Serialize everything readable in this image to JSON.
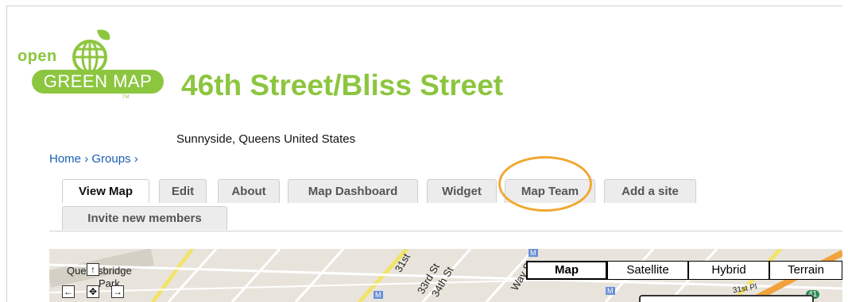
{
  "logo": {
    "open": "open",
    "name": "GREEN MAP",
    "tm": "TM"
  },
  "page": {
    "title": "46th Street/Bliss Street",
    "location": "Sunnyside, Queens United States"
  },
  "breadcrumb": {
    "items": [
      "Home",
      "Groups"
    ],
    "separator": "›"
  },
  "tabs": [
    {
      "label": "View Map",
      "active": true
    },
    {
      "label": "Edit"
    },
    {
      "label": "About"
    },
    {
      "label": "Map Dashboard"
    },
    {
      "label": "Widget"
    },
    {
      "label": "Map Team"
    },
    {
      "label": "Add a site"
    },
    {
      "label": "Invite new members"
    }
  ],
  "map": {
    "labels": {
      "neighborhood": "Queensbridge",
      "park": "Park",
      "street1": "31st",
      "street2": "33rd St",
      "street3": "34th St",
      "street4": "Way St",
      "street5": "31st Pl",
      "route": "M",
      "highway": "41"
    },
    "pan_controls": {
      "up": "↑",
      "left": "←",
      "center": "✥",
      "right": "→"
    },
    "types": [
      {
        "label": "Map",
        "active": true
      },
      {
        "label": "Satellite"
      },
      {
        "label": "Hybrid"
      },
      {
        "label": "Terrain"
      }
    ]
  },
  "colors": {
    "brand_green": "#8cc63f",
    "highlight": "#f0a833",
    "link": "#1a5fb4"
  }
}
